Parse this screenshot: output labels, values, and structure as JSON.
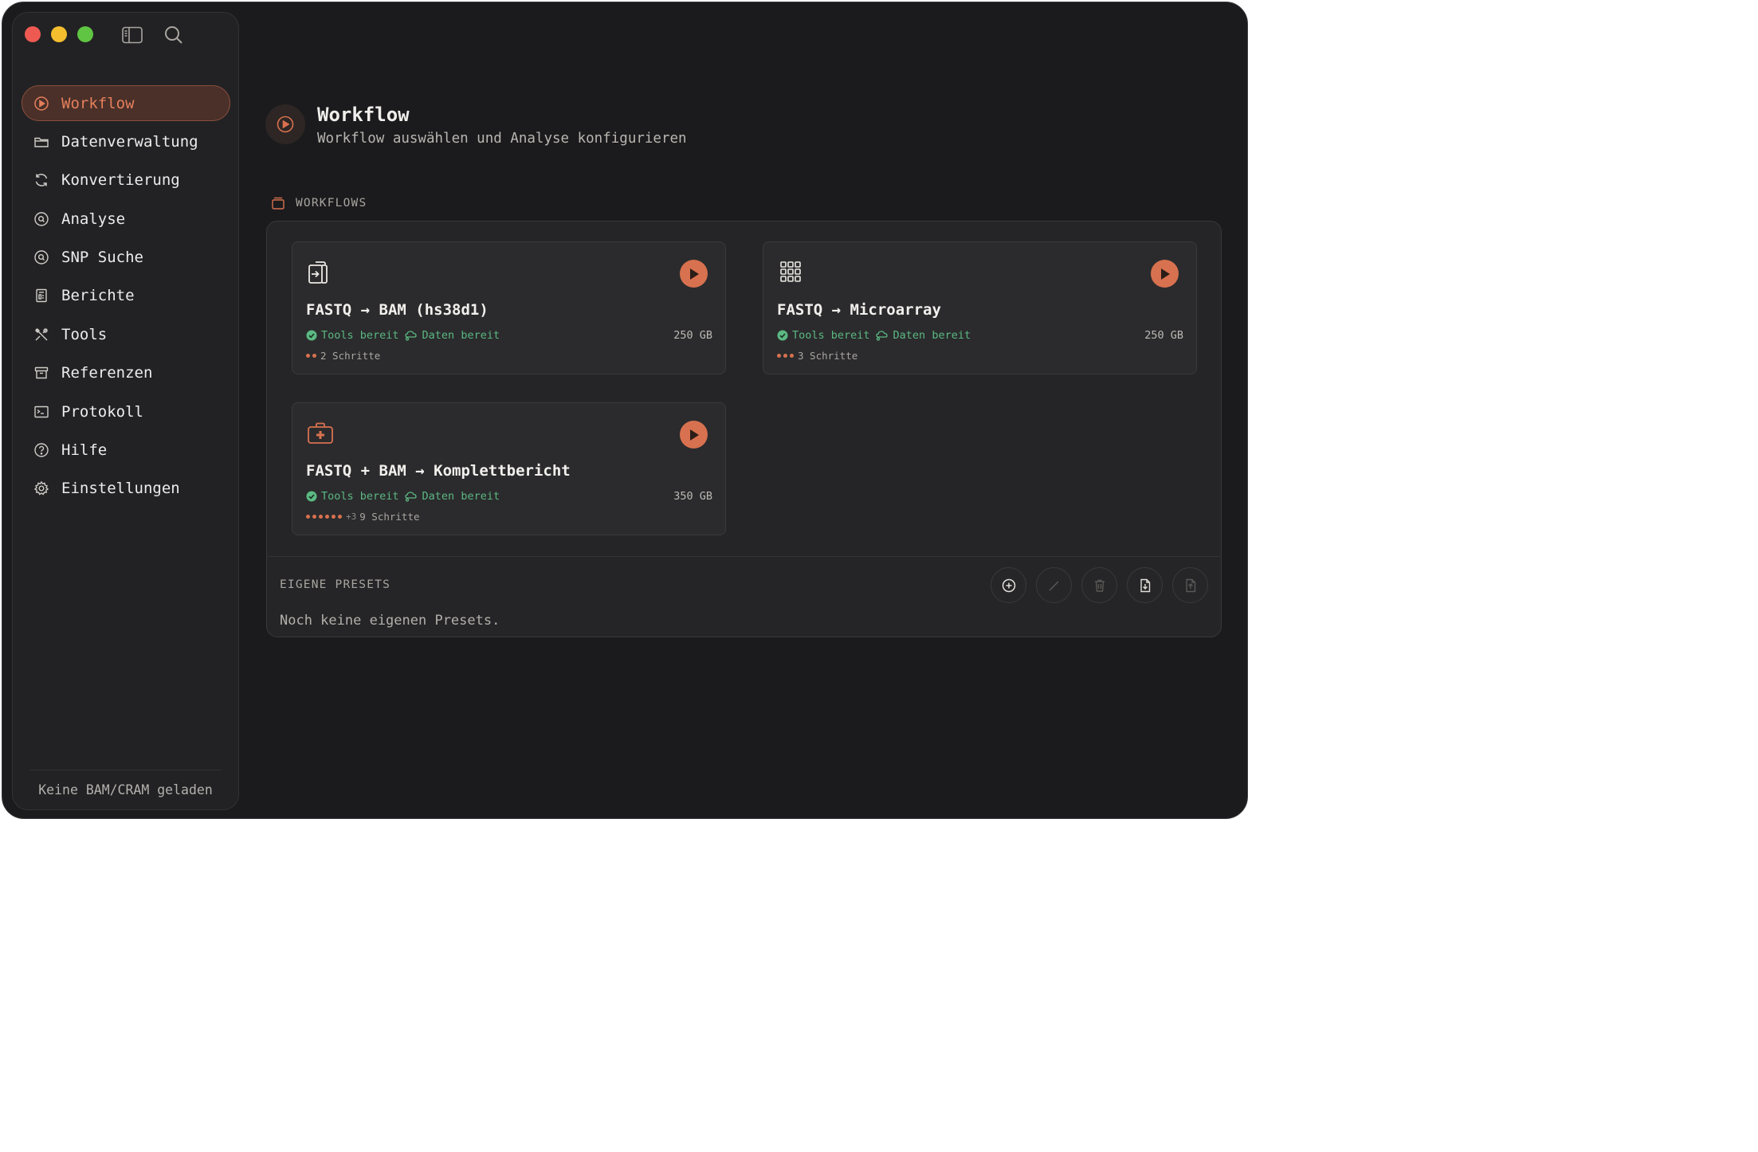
{
  "sidebar": {
    "items": [
      {
        "label": "Workflow",
        "icon": "play-circle-icon",
        "active": true
      },
      {
        "label": "Datenverwaltung",
        "icon": "folder-icon"
      },
      {
        "label": "Konvertierung",
        "icon": "refresh-icon"
      },
      {
        "label": "Analyse",
        "icon": "search-circle-icon"
      },
      {
        "label": "SNP Suche",
        "icon": "search-circle-icon"
      },
      {
        "label": "Berichte",
        "icon": "report-icon"
      },
      {
        "label": "Tools",
        "icon": "tools-icon"
      },
      {
        "label": "Referenzen",
        "icon": "archive-icon"
      },
      {
        "label": "Protokoll",
        "icon": "terminal-icon"
      },
      {
        "label": "Hilfe",
        "icon": "help-icon"
      },
      {
        "label": "Einstellungen",
        "icon": "gear-icon"
      }
    ],
    "footer": "Keine BAM/CRAM geladen"
  },
  "header": {
    "title": "Workflow",
    "subtitle": "Workflow auswählen und Analyse konfigurieren"
  },
  "workflows": {
    "section_label": "WORKFLOWS",
    "cards": [
      {
        "title": "FASTQ → BAM (hs38d1)",
        "icon": "file-convert-icon",
        "tools_status": "Tools bereit",
        "data_status": "Daten bereit",
        "size": "250 GB",
        "steps": "2 Schritte",
        "dot_count": 2,
        "more": ""
      },
      {
        "title": "FASTQ → Microarray",
        "icon": "grid-icon",
        "tools_status": "Tools bereit",
        "data_status": "Daten bereit",
        "size": "250 GB",
        "steps": "3 Schritte",
        "dot_count": 3,
        "more": ""
      },
      {
        "title": "FASTQ + BAM → Komplettbericht",
        "icon": "medical-kit-icon",
        "tools_status": "Tools bereit",
        "data_status": "Daten bereit",
        "size": "350 GB",
        "steps": "9 Schritte",
        "dot_count": 6,
        "more": "+3"
      }
    ]
  },
  "presets": {
    "label": "EIGENE PRESETS",
    "empty_text": "Noch keine eigenen Presets.",
    "actions": [
      "add-preset-icon",
      "edit-preset-icon",
      "delete-preset-icon",
      "import-preset-icon",
      "export-preset-icon"
    ]
  },
  "colors": {
    "accent": "#d8714f",
    "ready_green": "#5bb882",
    "background": "#1b1b1d",
    "sidebar": "#222224"
  }
}
